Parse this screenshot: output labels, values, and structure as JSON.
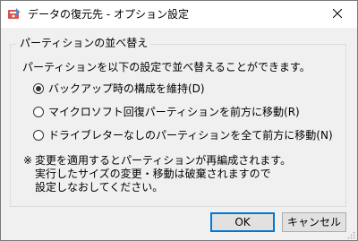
{
  "window": {
    "title": "データの復元先 - オプション設定",
    "app_icon": "disk-restore-icon",
    "close_icon": "close-icon"
  },
  "group": {
    "legend": "パーティションの並べ替え",
    "description": "パーティションを以下の設定で並べ替えることができます。",
    "options": [
      {
        "label": "バックアップ時の構成を維持(D)",
        "checked": true
      },
      {
        "label": "マイクロソフト回復パーティションを前方に移動(R)",
        "checked": false
      },
      {
        "label": "ドライブレターなしのパーティションを全て前方に移動(N)",
        "checked": false
      }
    ],
    "note_mark": "※",
    "note_lines": [
      "変更を適用するとパーティションが再編成されます。",
      "実行したサイズの変更・移動は破棄されますので",
      "設定しなおしてください。"
    ]
  },
  "buttons": {
    "ok": "OK",
    "cancel": "キャンセル"
  },
  "colors": {
    "accent": "#0078d7",
    "dialog_bg": "#f0f0f0",
    "titlebar_bg": "#ffffff"
  }
}
